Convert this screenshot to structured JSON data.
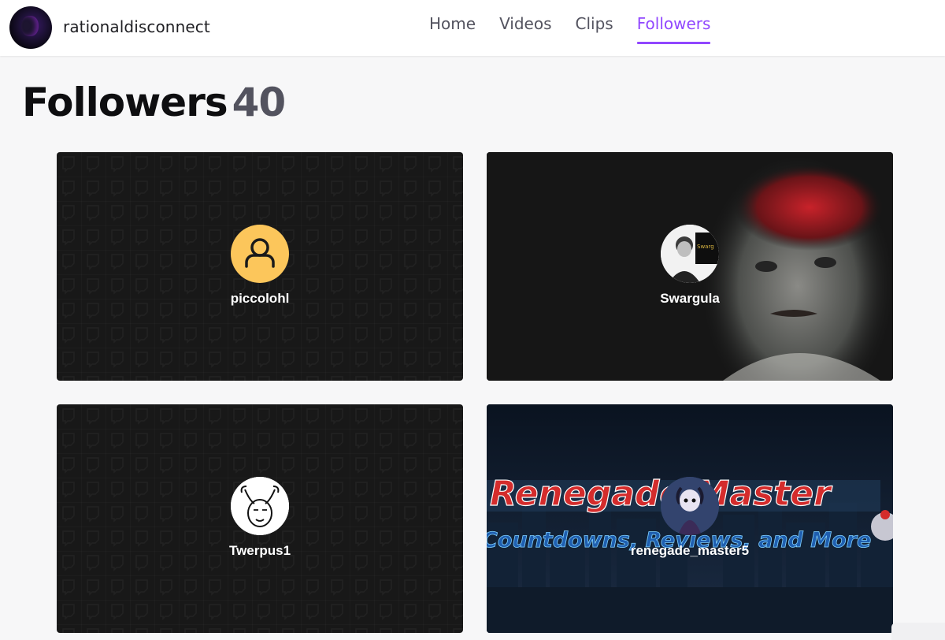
{
  "channel": {
    "name": "rationaldisconnect"
  },
  "nav": {
    "tabs": [
      {
        "label": "Home",
        "active": false
      },
      {
        "label": "Videos",
        "active": false
      },
      {
        "label": "Clips",
        "active": false
      },
      {
        "label": "Followers",
        "active": true
      }
    ]
  },
  "page": {
    "title": "Followers",
    "count": "40"
  },
  "followers": [
    {
      "name": "piccolohl",
      "avatar": "default-user-icon",
      "banner": "twitch-pattern"
    },
    {
      "name": "Swargula",
      "avatar": "photo",
      "banner": "photo"
    },
    {
      "name": "Twerpus1",
      "avatar": "drawing",
      "banner": "twitch-pattern"
    },
    {
      "name": "renegade_master5",
      "avatar": "photo",
      "banner": "graphic"
    }
  ],
  "banner_text": {
    "renegade_title": "Renegade Master",
    "renegade_subtitle": "Countdowns, Reviews, and More"
  },
  "colors": {
    "accent": "#9147ff",
    "default_avatar_bg": "#fcc65b"
  }
}
